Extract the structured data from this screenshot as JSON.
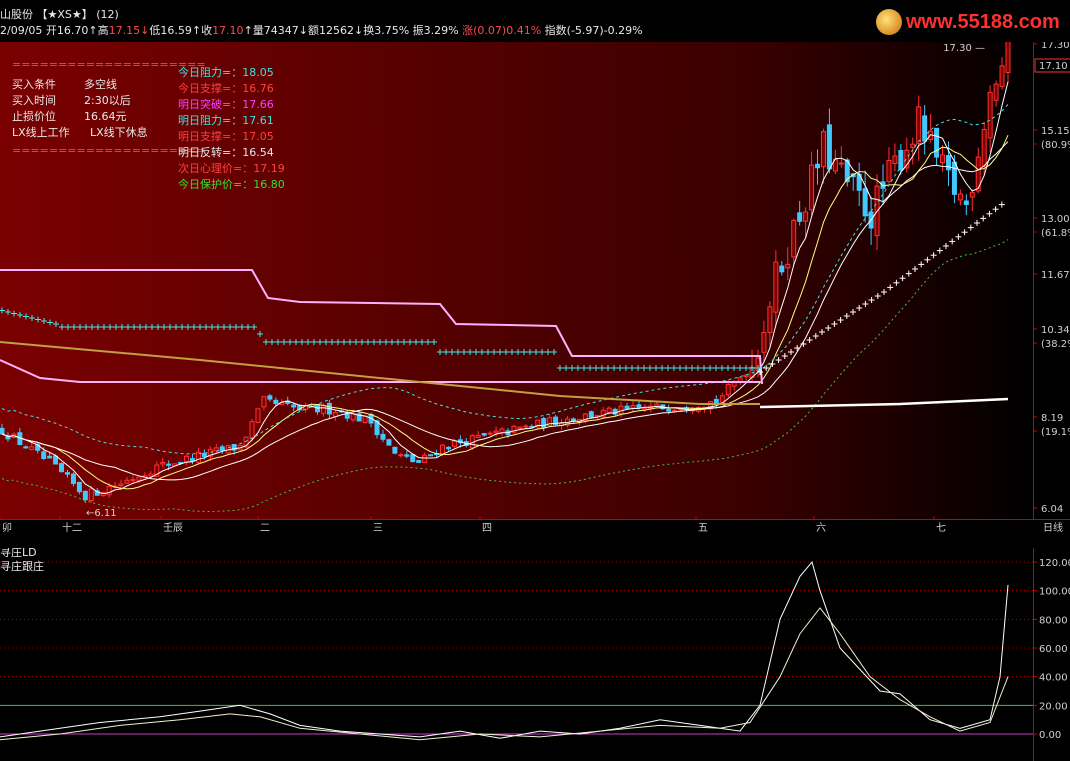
{
  "header": {
    "stock_name": "山股份",
    "tag": "【★XS★】",
    "count": "(12)",
    "date": "2/09/05",
    "fields": [
      {
        "label": "开",
        "value": "16.70",
        "arrow": "↑",
        "color": "#e8e8e8",
        "vcolor": "#e8e8e8"
      },
      {
        "label": "高",
        "value": "17.15",
        "arrow": "↓",
        "color": "#ff4a4a",
        "vcolor": "#ff4a4a"
      },
      {
        "label": "低",
        "value": "16.59",
        "arrow": "↑",
        "color": "#e8e8e8",
        "vcolor": "#e8e8e8"
      },
      {
        "label": "收",
        "value": "17.10",
        "arrow": "↑",
        "color": "#e8e8e8",
        "vcolor": "#ff4a4a"
      },
      {
        "label": "量",
        "value": "74347",
        "arrow": "↓",
        "color": "#e8e8e8",
        "vcolor": "#e8e8e8"
      },
      {
        "label": "额",
        "value": "12562",
        "arrow": "↓",
        "color": "#e8e8e8",
        "vcolor": "#e8e8e8"
      },
      {
        "label": "换",
        "value": "3.75%",
        "arrow": "",
        "color": "#e8e8e8",
        "vcolor": "#e8e8e8"
      },
      {
        "label": "振",
        "value": "3.29%",
        "arrow": "",
        "color": "#e8e8e8",
        "vcolor": "#e8e8e8"
      }
    ],
    "change_label": "涨",
    "change_value": "(0.07)",
    "change_pct": "0.41%",
    "index_label": "指数",
    "index_value": "(-5.97)-0.29%"
  },
  "logo": {
    "text": "www.55188.com"
  },
  "left_panel": {
    "divider": "=====================",
    "rows": [
      {
        "label": "买入条件",
        "value": "多空线"
      },
      {
        "label": "买入时间",
        "value": "2:30以后"
      },
      {
        "label": "止损价位",
        "value": "16.64元"
      },
      {
        "label": "LX线上工作",
        "value": "LX线下休息"
      }
    ]
  },
  "levels": [
    {
      "text": "今日阻力=：18.05",
      "color": "#40e0e0"
    },
    {
      "text": "今日支撑=：16.76",
      "color": "#ff4040"
    },
    {
      "text": "明日突破=：17.66",
      "color": "#ff40ff"
    },
    {
      "text": "明日阻力=：17.61",
      "color": "#40e0e0"
    },
    {
      "text": "明日支撑=：17.05",
      "color": "#ff4040"
    },
    {
      "text": "明日反转=：16.54",
      "color": "#e8e8e8"
    },
    {
      "text": "次日心理价=：17.19",
      "color": "#ff4040"
    },
    {
      "text": "今日保护价=：16.80",
      "color": "#33e033"
    }
  ],
  "main_axis": {
    "labels": [
      "17.30",
      "15.15",
      "(80.9%)",
      "13.00",
      "(61.8%)",
      "11.67",
      "10.34",
      "(38.2%)",
      "8.19",
      "(19.1%)",
      "6.04"
    ],
    "current_price": "17.10",
    "high_mark": "17.30",
    "low_mark": "6.11"
  },
  "x_axis": {
    "labels": [
      "卯",
      "十二",
      "壬辰",
      "二",
      "三",
      "四",
      "五",
      "六",
      "七"
    ],
    "period": "日线"
  },
  "sub_panel": {
    "title": "寻庄LD",
    "subtitle": "寻庄跟庄",
    "axis_labels": [
      "120.00",
      "100.00",
      "80.00",
      "60.00",
      "40.00",
      "20.00",
      "0.00"
    ]
  },
  "chart_data": {
    "type": "line",
    "price_range": [
      6.04,
      17.3
    ],
    "oscillator_range": [
      0,
      120
    ],
    "oscillator_reference_lines": [
      20,
      0
    ],
    "last_close": 17.1
  },
  "colors": {
    "background_top": "#7a0000",
    "up_candle": "#ff3030",
    "down_candle": "#40c8ff",
    "grid": "#cc0000",
    "ma_pink": "#ffb0ff",
    "ma_cyan": "#40e8e8",
    "ma_olive": "#c0a040",
    "ma_white": "#ffffff",
    "line_green": "#40c040",
    "line_yellow": "#ffff80"
  }
}
